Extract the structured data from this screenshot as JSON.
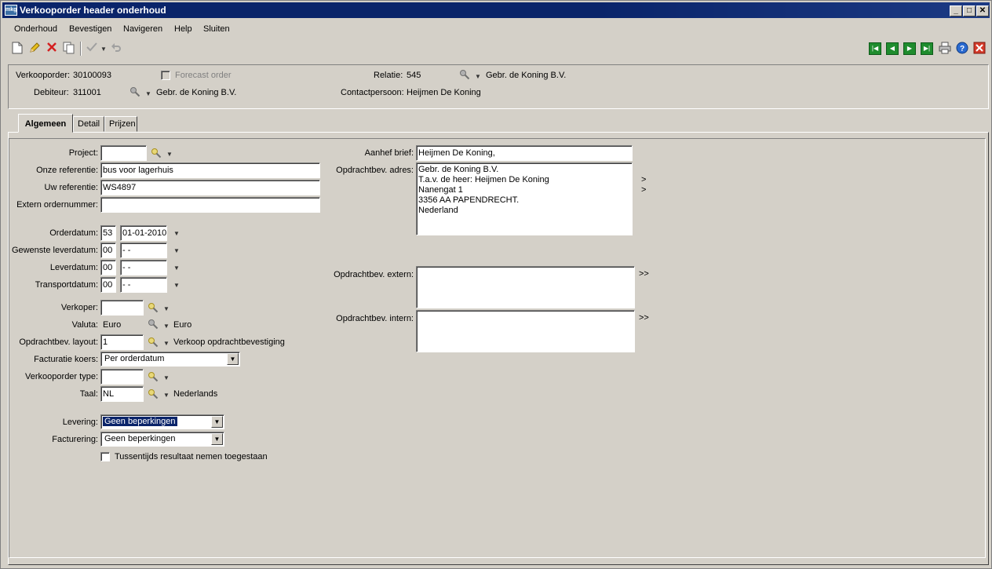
{
  "window": {
    "title": "Verkooporder header onderhoud",
    "app_icon_text": "mkg",
    "minimize": "_",
    "maximize": "□",
    "close": "✕"
  },
  "menu": [
    "Onderhoud",
    "Bevestigen",
    "Navigeren",
    "Help",
    "Sluiten"
  ],
  "header": {
    "verkooporder_label": "Verkooporder:",
    "verkooporder_value": "30100093",
    "forecast_label": "Forecast order",
    "relatie_label": "Relatie:",
    "relatie_value": "545",
    "relatie_name": "Gebr. de Koning B.V.",
    "debiteur_label": "Debiteur:",
    "debiteur_value": "311001",
    "debiteur_name": "Gebr. de Koning B.V.",
    "contactpersoon_label": "Contactpersoon:",
    "contactpersoon_value": "Heijmen De Koning"
  },
  "tabs": [
    "Algemeen",
    "Detail",
    "Prijzen"
  ],
  "form": {
    "project_label": "Project:",
    "project_value": "",
    "onze_ref_label": "Onze referentie:",
    "onze_ref_value": "bus voor lagerhuis",
    "uw_ref_label": "Uw referentie:",
    "uw_ref_value": "WS4897",
    "extern_label": "Extern ordernummer:",
    "extern_value": "",
    "orderdatum_label": "Orderdatum:",
    "orderdatum_week": "53",
    "orderdatum_date": "01-01-2010",
    "gewenste_label": "Gewenste leverdatum:",
    "gewenste_week": "00",
    "gewenste_date": " -  - ",
    "leverdatum_label": "Leverdatum:",
    "leverdatum_week": "00",
    "leverdatum_date": " -  - ",
    "transport_label": "Transportdatum:",
    "transport_week": "00",
    "transport_date": " -  - ",
    "verkoper_label": "Verkoper:",
    "verkoper_value": "",
    "valuta_label": "Valuta:",
    "valuta_value": "Euro",
    "valuta_name": "Euro",
    "layout_label": "Opdrachtbev. layout:",
    "layout_value": "1",
    "layout_name": "Verkoop opdrachtbevestiging",
    "koers_label": "Facturatie koers:",
    "koers_value": "Per orderdatum",
    "type_label": "Verkooporder type:",
    "type_value": "",
    "taal_label": "Taal:",
    "taal_value": "NL",
    "taal_name": "Nederlands",
    "levering_label": "Levering:",
    "levering_value": "Geen beperkingen",
    "facturering_label": "Facturering:",
    "facturering_value": "Geen beperkingen",
    "tussentijds_label": "Tussentijds resultaat nemen toegestaan",
    "aanhef_label": "Aanhef brief:",
    "aanhef_value": "Heijmen De Koning,",
    "adres_label": "Opdrachtbev. adres:",
    "adres_value": "Gebr. de Koning B.V.\nT.a.v. de heer: Heijmen De Koning\nNanengat 1\n3356 AA PAPENDRECHT.\nNederland",
    "extern_text_label": "Opdrachtbev. extern:",
    "extern_text_value": "",
    "intern_text_label": "Opdrachtbev. intern:",
    "intern_text_value": "",
    "expand_symbol": ">>",
    "arrow_symbol": ">"
  }
}
